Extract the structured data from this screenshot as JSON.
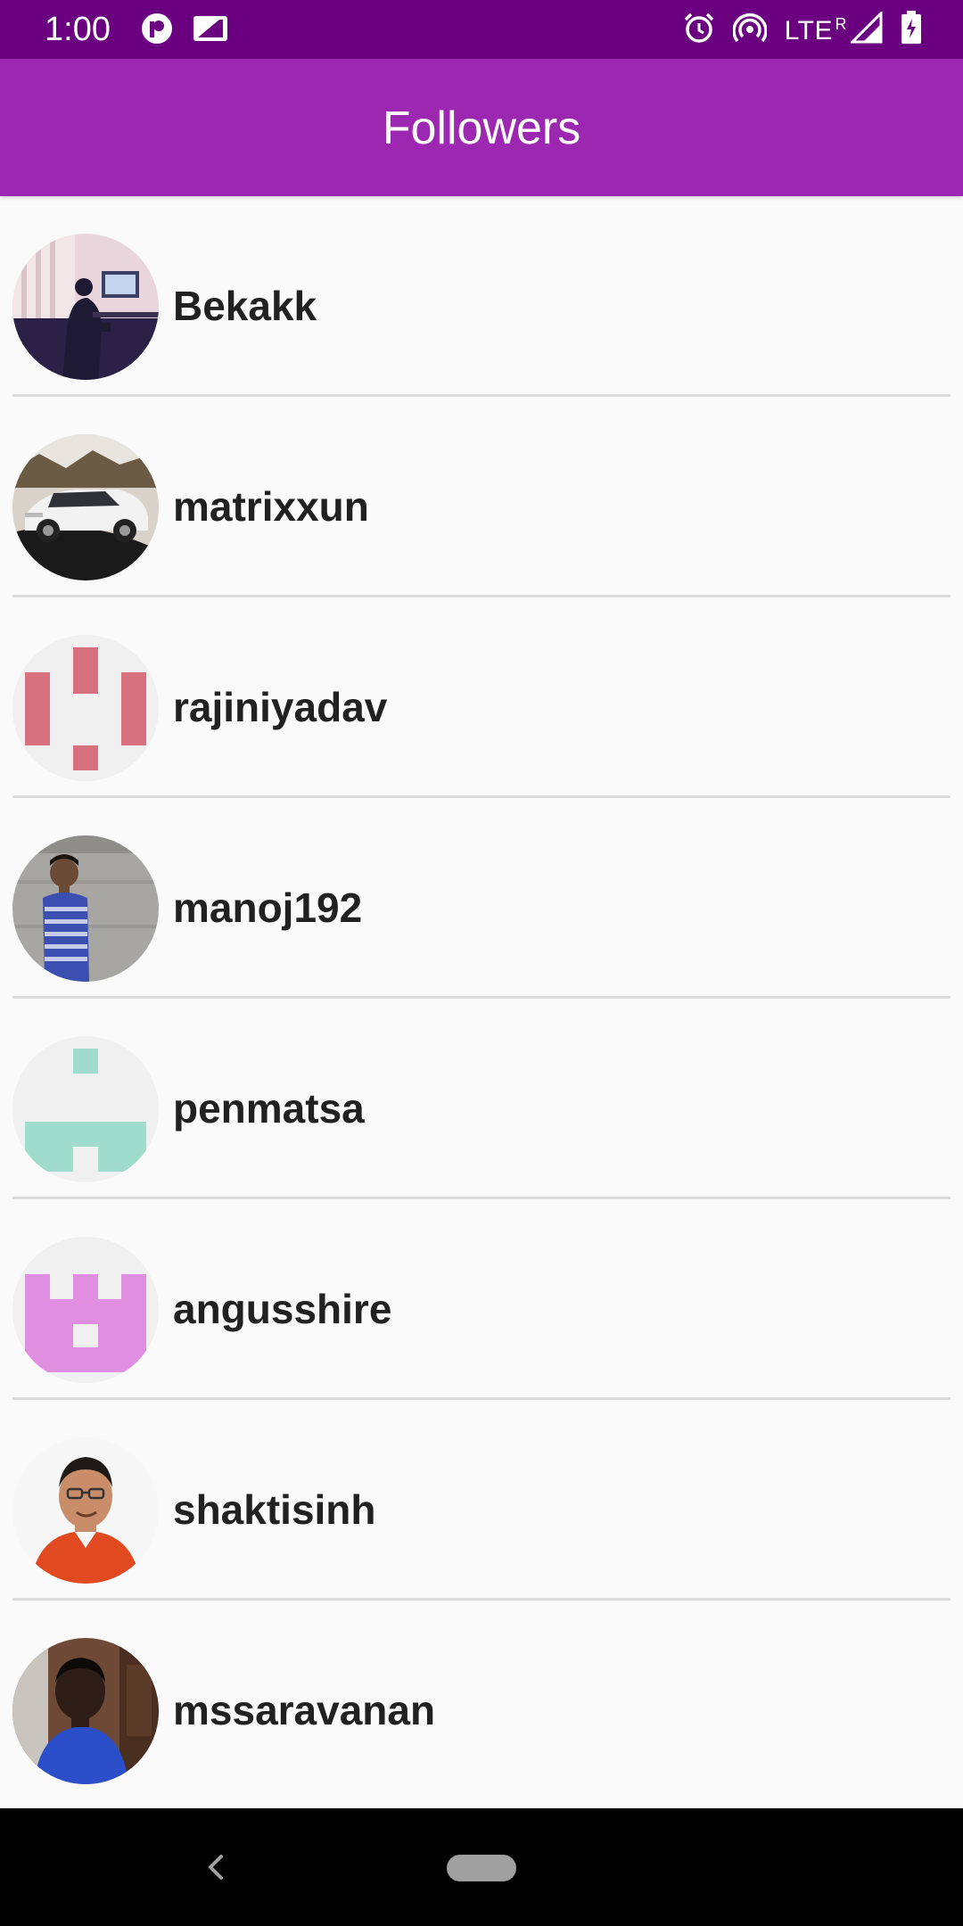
{
  "status_bar": {
    "time": "1:00",
    "network": "LTE",
    "roaming": "R",
    "background_color": "#6a0080"
  },
  "app_bar": {
    "title": "Followers",
    "background_color": "#9c27b0"
  },
  "followers": [
    {
      "username": "Bekakk",
      "avatar": "photo-person-at-computer"
    },
    {
      "username": "matrixxun",
      "avatar": "photo-white-car"
    },
    {
      "username": "rajiniyadav",
      "avatar": "identicon-pink"
    },
    {
      "username": "manoj192",
      "avatar": "photo-person-striped-shirt"
    },
    {
      "username": "penmatsa",
      "avatar": "identicon-teal"
    },
    {
      "username": "angusshire",
      "avatar": "identicon-violet"
    },
    {
      "username": "shaktisinh",
      "avatar": "photo-man-glasses-red-shirt"
    },
    {
      "username": "mssaravanan",
      "avatar": "photo-man-blue-shirt"
    }
  ],
  "nav_bar": {
    "back_icon": "chevron-left-icon",
    "home_icon": "home-pill-icon"
  }
}
